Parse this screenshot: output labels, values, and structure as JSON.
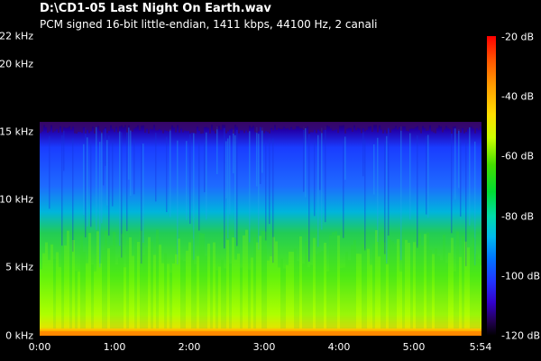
{
  "window": {
    "file_title": "D:\\CD1-05 Last Night On Earth.wav",
    "format_info": "PCM signed 16-bit little-endian, 1411 kbps, 44100 Hz, 2 canali"
  },
  "spectrogram": {
    "freq_axis": [
      "22 kHz",
      "20 kHz",
      "15 kHz",
      "10 kHz",
      "5 kHz",
      "0 kHz"
    ],
    "time_axis": [
      "0:00",
      "1:00",
      "2:00",
      "3:00",
      "4:00",
      "5:00",
      "5:54"
    ],
    "colorbar": [
      "-20 dB",
      "-40 dB",
      "-60 dB",
      "-80 dB",
      "-100 dB",
      "-120 dB"
    ],
    "cutoff_khz": 15.7,
    "duration": "5:54"
  },
  "colors": {
    "background": "#000000",
    "high": "#ff0000",
    "mid": "#00dd33",
    "low": "#2233ff"
  }
}
